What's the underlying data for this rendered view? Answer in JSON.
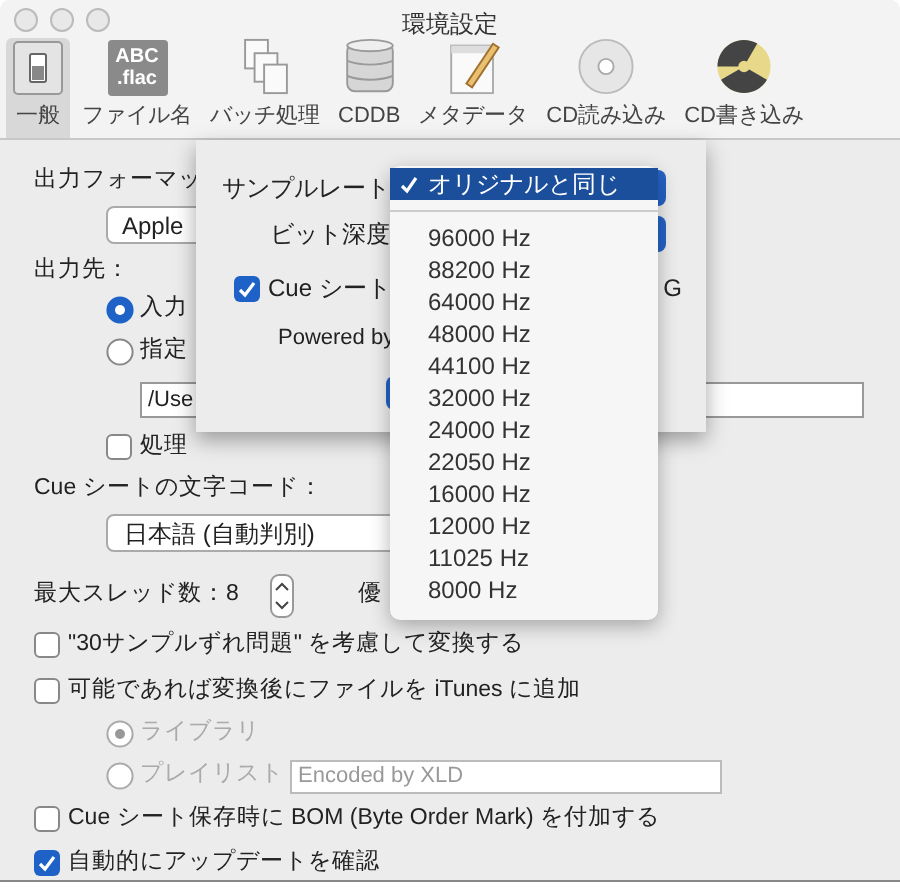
{
  "window": {
    "title": "環境設定"
  },
  "toolbar": [
    {
      "label": "一般",
      "selected": true,
      "kind": "switch"
    },
    {
      "label": "ファイル名",
      "selected": false,
      "kind": "tag",
      "icon_text": [
        "ABC",
        ".flac"
      ]
    },
    {
      "label": "バッチ処理",
      "selected": false,
      "kind": "documents"
    },
    {
      "label": "CDDB",
      "selected": false,
      "kind": "database"
    },
    {
      "label": "メタデータ",
      "selected": false,
      "kind": "notepad"
    },
    {
      "label": "CD読み込み",
      "selected": false,
      "kind": "disc"
    },
    {
      "label": "CD書き込み",
      "selected": false,
      "kind": "burn"
    }
  ],
  "general": {
    "output_format_label": "出力フォーマッ",
    "format_popup": "Apple",
    "destination_label": "出力先：",
    "destination_options": [
      {
        "label": "入力",
        "selected": true
      },
      {
        "label": "指定",
        "selected": false
      }
    ],
    "path_field": "/Use",
    "process_checkbox": {
      "label": "処理",
      "checked": false
    },
    "cue_encoding_label": "Cue シートの文字コード：",
    "cue_encoding_popup": "日本語 (自動判別)",
    "threads_label": "最大スレッド数：8",
    "priority_label": "優",
    "options": [
      {
        "label": "\"30サンプルずれ問題\" を考慮して変換する",
        "checked": false
      },
      {
        "label": "可能であれば変換後にファイルを iTunes に追加",
        "checked": false
      }
    ],
    "itunes_targets": [
      {
        "label": "ライブラリ",
        "selected": true,
        "disabled": true
      },
      {
        "label": "プレイリスト",
        "selected": false,
        "disabled": true
      }
    ],
    "playlist_field_placeholder": "Encoded by XLD",
    "more_options": [
      {
        "label": "Cue シート保存時に BOM (Byte Order Mark) を付加する",
        "checked": false
      },
      {
        "label": "自動的にアップデートを確認",
        "checked": true
      }
    ]
  },
  "sheet": {
    "sample_rate_label": "サンプルレート",
    "bit_depth_label": "ビット深度",
    "cue_checkbox": {
      "label": "Cue シート",
      "checked": true
    },
    "cut_text": "G",
    "powered_by": "Powered by"
  },
  "menu": {
    "items": [
      {
        "label": "オリジナルと同じ",
        "selected": true
      },
      {
        "label": "96000 Hz",
        "selected": false
      },
      {
        "label": "88200 Hz",
        "selected": false
      },
      {
        "label": "64000 Hz",
        "selected": false
      },
      {
        "label": "48000 Hz",
        "selected": false
      },
      {
        "label": "44100 Hz",
        "selected": false
      },
      {
        "label": "32000 Hz",
        "selected": false
      },
      {
        "label": "24000 Hz",
        "selected": false
      },
      {
        "label": "22050 Hz",
        "selected": false
      },
      {
        "label": "16000 Hz",
        "selected": false
      },
      {
        "label": "12000 Hz",
        "selected": false
      },
      {
        "label": "11025 Hz",
        "selected": false
      },
      {
        "label": "8000 Hz",
        "selected": false
      }
    ]
  }
}
